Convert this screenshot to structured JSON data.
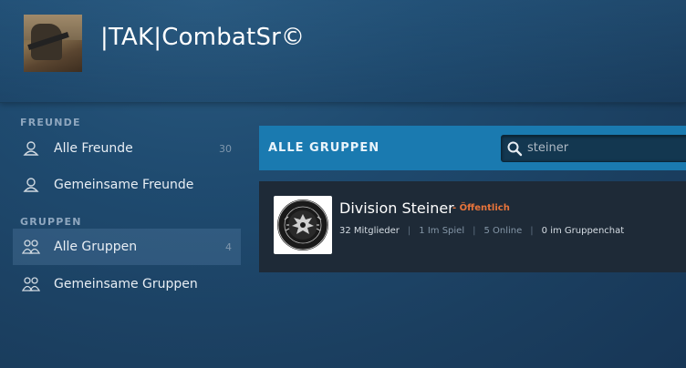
{
  "profile": {
    "username": "|TAK|CombatSr©"
  },
  "sidebar": {
    "friends_section": "FREUNDE",
    "groups_section": "GRUPPEN",
    "items": [
      {
        "label": "Alle Freunde",
        "count": "30",
        "icon": "person-icon"
      },
      {
        "label": "Gemeinsame Freunde",
        "count": "",
        "icon": "person-icon"
      },
      {
        "label": "Alle Gruppen",
        "count": "4",
        "icon": "group-icon"
      },
      {
        "label": "Gemeinsame Gruppen",
        "count": "",
        "icon": "group-icon"
      }
    ]
  },
  "groups": {
    "title": "ALLE GRUPPEN",
    "search_value": "steiner",
    "search_icon": "magnifier-icon",
    "results": [
      {
        "name": "Division Steiner",
        "visibility": "- Öffentlich",
        "members": "32 Mitglieder",
        "in_game": "1 Im Spiel",
        "online": "5 Online",
        "in_chat": "0 im Gruppenchat"
      }
    ]
  },
  "colors": {
    "accent_bar": "#1a7ab0",
    "visibility": "#e8743b",
    "card_bg": "#1e2a37"
  }
}
